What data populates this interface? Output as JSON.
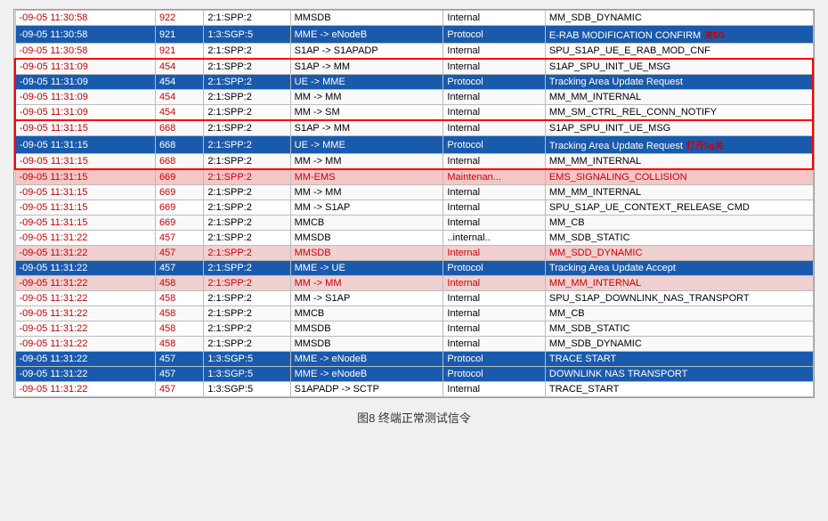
{
  "caption": "图8  终端正常测试信令",
  "annotations": {
    "close_5g_1": "关5G",
    "close_5g_2": "打开5g关",
    "open_5g": "打开5g关"
  },
  "rows": [
    {
      "time": "-09-05 11:30:58",
      "id": "922",
      "comp": "2:1:SPP:2",
      "src": "MMSDB",
      "type": "Internal",
      "msg": "MM_SDB_DYNAMIC",
      "style": "white"
    },
    {
      "time": "-09-05 11:30:58",
      "id": "921",
      "comp": "1:3:SGP:5",
      "src": "MME -> eNodeB",
      "type": "Protocol",
      "msg": "E-RAB MODIFICATION CONFIRM",
      "style": "blue",
      "annot": "关5G"
    },
    {
      "time": "-09-05 11:30:58",
      "id": "921",
      "comp": "2:1:SPP:2",
      "src": "S1AP -> S1APADP",
      "type": "Internal",
      "msg": "SPU_S1AP_UE_E_RAB_MOD_CNF",
      "style": "white"
    },
    {
      "time": "-09-05 11:31:09",
      "id": "454",
      "comp": "2:1:SPP:2",
      "src": "S1AP -> MM",
      "type": "Internal",
      "msg": "S1AP_SPU_INIT_UE_MSG",
      "style": "white",
      "box_top": true
    },
    {
      "time": "-09-05 11:31:09",
      "id": "454",
      "comp": "2:1:SPP:2",
      "src": "UE -> MME",
      "type": "Protocol",
      "msg": "Tracking Area Update Request",
      "style": "blue",
      "box_mid": true
    },
    {
      "time": "-09-05 11:31:09",
      "id": "454",
      "comp": "2:1:SPP:2",
      "src": "MM -> MM",
      "type": "Internal",
      "msg": "MM_MM_INTERNAL",
      "style": "white",
      "box_mid": true
    },
    {
      "time": "-09-05 11:31:09",
      "id": "454",
      "comp": "2:1:SPP:2",
      "src": "MM -> SM",
      "type": "Internal",
      "msg": "MM_SM_CTRL_REL_CONN_NOTIFY",
      "style": "white",
      "box_bottom": true
    },
    {
      "time": "-09-05 11:31:15",
      "id": "668",
      "comp": "2:1:SPP:2",
      "src": "S1AP -> MM",
      "type": "Internal",
      "msg": "S1AP_SPU_INIT_UE_MSG",
      "style": "white",
      "box2_top": true
    },
    {
      "time": "-09-05 11:31:15",
      "id": "668",
      "comp": "2:1:SPP:2",
      "src": "UE -> MME",
      "type": "Protocol",
      "msg": "Tracking Area Update Request",
      "style": "blue",
      "box2_mid": true,
      "annot": "打开5g关"
    },
    {
      "time": "-09-05 11:31:15",
      "id": "668",
      "comp": "2:1:SPP:2",
      "src": "MM -> MM",
      "type": "Internal",
      "msg": "MM_MM_INTERNAL",
      "style": "white",
      "box2_bottom": true
    },
    {
      "time": "-09-05 11:31:15",
      "id": "669",
      "comp": "2:1:SPP:2",
      "src": "MM-EMS",
      "type": "Maintenan...",
      "msg": "EMS_SIGNALING_COLLISION",
      "style": "pink-red"
    },
    {
      "time": "-09-05 11:31:15",
      "id": "669",
      "comp": "2:1:SPP:2",
      "src": "MM -> MM",
      "type": "Internal",
      "msg": "MM_MM_INTERNAL",
      "style": "white"
    },
    {
      "time": "-09-05 11:31:15",
      "id": "669",
      "comp": "2:1:SPP:2",
      "src": "MM -> S1AP",
      "type": "Internal",
      "msg": "SPU_S1AP_UE_CONTEXT_RELEASE_CMD",
      "style": "white"
    },
    {
      "time": "-09-05 11:31:15",
      "id": "669",
      "comp": "2:1:SPP:2",
      "src": "MMCB",
      "type": "Internal",
      "msg": "MM_CB",
      "style": "white"
    },
    {
      "time": "-09-05 11:31:22",
      "id": "457",
      "comp": "2:1:SPP:2",
      "src": "MMSDB",
      "type": "..internal..",
      "msg": "MM_SDB_STATIC",
      "style": "white"
    },
    {
      "time": "-09-05 11:31:22",
      "id": "457",
      "comp": "2:1:SPP:2",
      "src": "MMSDB",
      "type": "Internal",
      "msg": "MM_SDD_DYNAMIC",
      "style": "pink"
    },
    {
      "time": "-09-05 11:31:22",
      "id": "457",
      "comp": "2:1:SPP:2",
      "src": "MME -> UE",
      "type": "Protocol",
      "msg": "Tracking Area Update Accept",
      "style": "blue-outline"
    },
    {
      "time": "-09-05 11:31:22",
      "id": "458",
      "comp": "2:1:SPP:2",
      "src": "MM -> MM",
      "type": "Internal",
      "msg": "MM_MM_INTERNAL",
      "style": "pink"
    },
    {
      "time": "-09-05 11:31:22",
      "id": "458",
      "comp": "2:1:SPP:2",
      "src": "MM -> S1AP",
      "type": "Internal",
      "msg": "SPU_S1AP_DOWNLINK_NAS_TRANSPORT",
      "style": "white"
    },
    {
      "time": "-09-05 11:31:22",
      "id": "458",
      "comp": "2:1:SPP:2",
      "src": "MMCB",
      "type": "Internal",
      "msg": "MM_CB",
      "style": "white"
    },
    {
      "time": "-09-05 11:31:22",
      "id": "458",
      "comp": "2:1:SPP:2",
      "src": "MMSDB",
      "type": "Internal",
      "msg": "MM_SDB_STATIC",
      "style": "white"
    },
    {
      "time": "-09-05 11:31:22",
      "id": "458",
      "comp": "2:1:SPP:2",
      "src": "MMSDB",
      "type": "Internal",
      "msg": "MM_SDB_DYNAMIC",
      "style": "white"
    },
    {
      "time": "-09-05 11:31:22",
      "id": "457",
      "comp": "1:3:SGP:5",
      "src": "MME -> eNodeB",
      "type": "Protocol",
      "msg": "TRACE START",
      "style": "blue"
    },
    {
      "time": "-09-05 11:31:22",
      "id": "457",
      "comp": "1:3:SGP:5",
      "src": "MME -> eNodeB",
      "type": "Protocol",
      "msg": "DOWNLINK NAS TRANSPORT",
      "style": "blue"
    },
    {
      "time": "-09-05 11:31:22",
      "id": "457",
      "comp": "1:3:SGP:5",
      "src": "S1APADP -> SCTP",
      "type": "Internal",
      "msg": "TRACE_START",
      "style": "white"
    }
  ]
}
